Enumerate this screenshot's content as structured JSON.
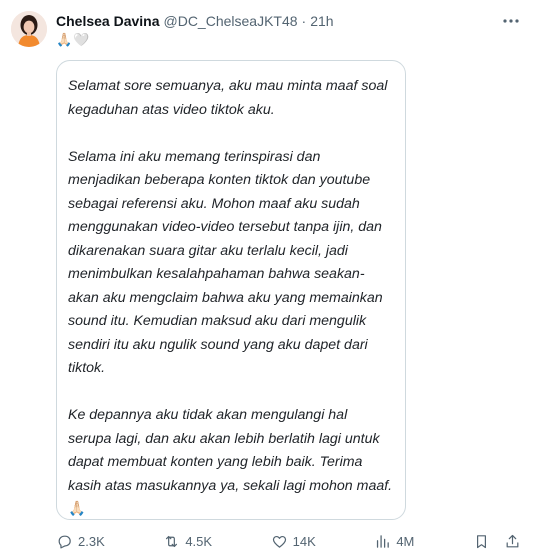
{
  "author": {
    "display_name": "Chelsea Davina",
    "handle": "@DC_ChelseaJKT48",
    "separator": "·",
    "time": "21h"
  },
  "post_prefix_emoji": "🙏🏻🤍",
  "quote": {
    "paragraphs": [
      "Selamat sore semuanya, aku mau minta maaf soal kegaduhan atas video tiktok aku.",
      "Selama ini aku memang terinspirasi dan menjadikan beberapa konten tiktok dan youtube sebagai referensi aku. Mohon maaf aku sudah menggunakan video-video tersebut tanpa ijin, dan dikarenakan suara gitar aku terlalu kecil, jadi menimbulkan kesalahpahaman bahwa seakan-akan aku mengclaim bahwa aku yang memainkan sound itu. Kemudian maksud aku dari mengulik sendiri itu aku ngulik sound yang aku dapet dari tiktok.",
      "Ke depannya aku tidak akan mengulangi hal serupa lagi, dan aku akan lebih berlatih lagi untuk dapat membuat konten yang lebih baik. Terima kasih atas masukannya ya, sekali lagi mohon maaf."
    ],
    "closing_emoji": "🙏🏻"
  },
  "metrics": {
    "replies": "2.3K",
    "reposts": "4.5K",
    "likes": "14K",
    "views": "4M"
  },
  "icons": {
    "more": "more-horizontal-icon",
    "reply": "reply-icon",
    "repost": "repost-icon",
    "like": "heart-icon",
    "views": "views-chart-icon",
    "bookmark": "bookmark-icon",
    "share": "share-icon"
  },
  "colors": {
    "text_primary": "#0f1419",
    "text_secondary": "#536471",
    "border": "#cfd9de",
    "avatar_shirt": "#f28a2e"
  }
}
